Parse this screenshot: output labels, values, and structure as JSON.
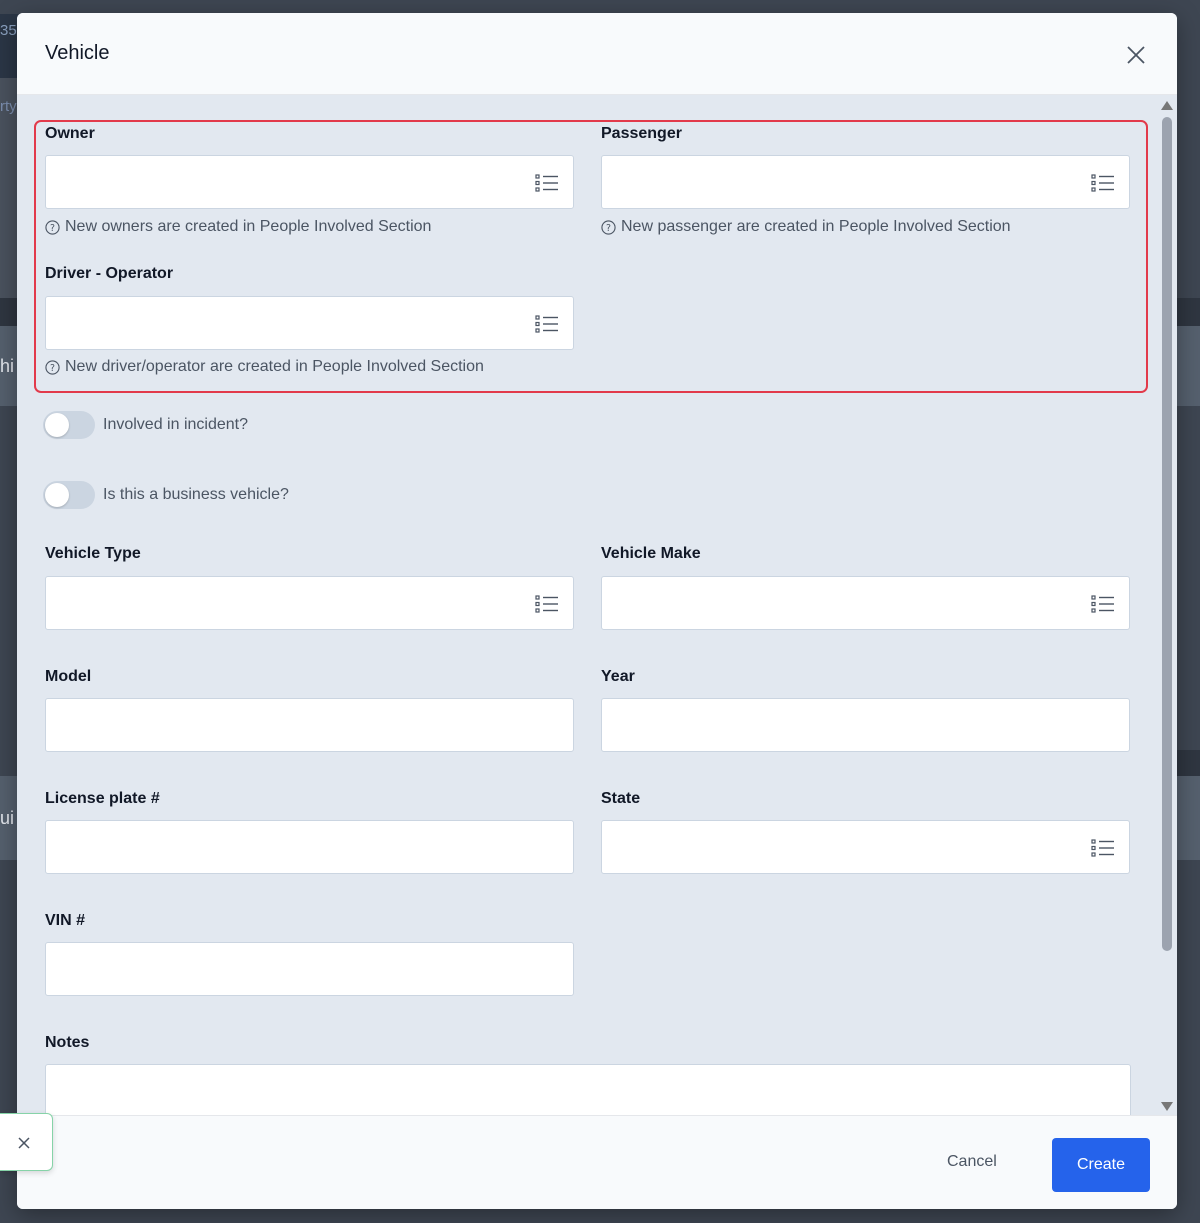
{
  "background": {
    "top_fragment": "35",
    "left_fragment_a": "rty",
    "left_fragment_c": "hi",
    "left_fragment_d": "ui"
  },
  "modal": {
    "title": "Vehicle",
    "fields": {
      "owner": {
        "label": "Owner",
        "value": "",
        "hint": "New owners are created in People Involved Section"
      },
      "passenger": {
        "label": "Passenger",
        "value": "",
        "hint": "New passenger are created in People Involved Section"
      },
      "driver": {
        "label": "Driver - Operator",
        "value": "",
        "hint": "New driver/operator are created in People Involved Section"
      },
      "vehicle_type": {
        "label": "Vehicle Type",
        "value": ""
      },
      "vehicle_make": {
        "label": "Vehicle Make",
        "value": ""
      },
      "model": {
        "label": "Model",
        "value": ""
      },
      "year": {
        "label": "Year",
        "value": ""
      },
      "license_plate": {
        "label": "License plate #",
        "value": ""
      },
      "state": {
        "label": "State",
        "value": ""
      },
      "vin": {
        "label": "VIN #",
        "value": ""
      },
      "notes": {
        "label": "Notes",
        "value": ""
      }
    },
    "toggles": {
      "involved": {
        "label": "Involved in incident?",
        "on": false
      },
      "business": {
        "label": "Is this a business vehicle?",
        "on": false
      }
    },
    "footer": {
      "cancel_label": "Cancel",
      "create_label": "Create"
    }
  },
  "colors": {
    "primary": "#2563eb",
    "highlight": "#e23a4b",
    "form_bg": "#e2e8f0"
  },
  "icons": {
    "close": "close-icon",
    "list": "list-icon",
    "help": "question-circle-icon"
  }
}
